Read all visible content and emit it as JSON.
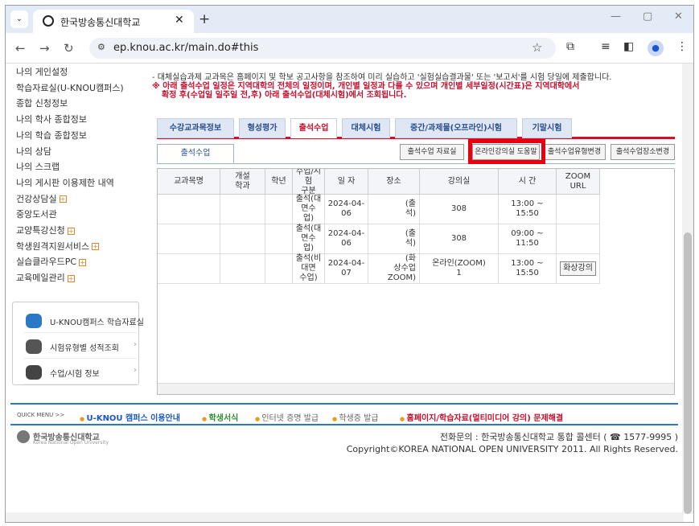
{
  "browser": {
    "tab_title": "한국방송통신대학교",
    "url": "ep.knou.ac.kr/main.do#this"
  },
  "sidebar": {
    "items": [
      {
        "label": "나의 게인설정",
        "plus": false
      },
      {
        "label": "학습자료실(U-KNOU캠퍼스)",
        "plus": false
      },
      {
        "label": "종합 신청정보",
        "plus": false
      },
      {
        "label": "나의 학사 종합정보",
        "plus": false
      },
      {
        "label": "나의 학습 종합정보",
        "plus": false
      },
      {
        "label": "나의 상담",
        "plus": false
      },
      {
        "label": "나의 스크랩",
        "plus": false
      },
      {
        "label": "나의 게시판 이용제한 내역",
        "plus": false
      },
      {
        "label": "건강상담실",
        "plus": true
      },
      {
        "label": "중앙도서관",
        "plus": false
      },
      {
        "label": "교양특강신청",
        "plus": true
      },
      {
        "label": "학생원격지원서비스",
        "plus": true
      },
      {
        "label": "실습클라우드PC",
        "plus": true
      },
      {
        "label": "교육메일관리",
        "plus": true
      }
    ],
    "quick": [
      {
        "label": "U-KNOU캠퍼스 학습자료실"
      },
      {
        "label": "시험유형별 성적조회"
      },
      {
        "label": "수업/시험 정보"
      }
    ]
  },
  "notice": {
    "line1": "- 대체실습과제 교과목은 홈페이지 및 학보 공고사항을 참조하여 미리 실습하고 '실험실습결과물' 또는 '보고서'를 시험 당일에 제출합니다.",
    "line2": "※ 아래 출석수업 일정은 지역대학의 전체의 일정이며, 개인별 일정과 다를 수 있으며 개인별 세부일정(시간표)은 지역대학에서",
    "line3": "확정 후(수업일 일주일 전,후) 아래 출석수업(대체시험)에서 조회됩니다."
  },
  "tabs": [
    "수강교과목정보",
    "형성평가",
    "출석수업",
    "대체시험",
    "중간/과제물(오프라인)시험",
    "기말시험"
  ],
  "active_tab": 2,
  "subtab": "출석수업",
  "buttons": [
    "출석수업 자료실",
    "온라인강의실 도움말",
    "출석수업유형변경",
    "출석수업장소변경"
  ],
  "table": {
    "headers": [
      "교과목명",
      "개설\n학과",
      "학년",
      "수업/시험\n구분",
      "일  자",
      "장소",
      "강의실",
      "시  간",
      "ZOOM\nURL"
    ],
    "rows": [
      [
        "",
        "",
        "",
        "출석(대면수\n업)",
        "2024-04-06",
        "(출\n석)",
        "308",
        "13:00 ~\n15:50",
        ""
      ],
      [
        "",
        "",
        "",
        "출석(대면수\n업)",
        "2024-04-06",
        "(출\n석)",
        "308",
        "09:00 ~\n11:50",
        ""
      ],
      [
        "",
        "",
        "",
        "출석(비대면\n수업)",
        "2024-04-07",
        "(화\n상수업ZOOM)",
        "온라인(ZOOM)\n1",
        "13:00 ~\n15:50",
        "화상강의"
      ]
    ]
  },
  "quickmenu": {
    "label": "QUICK MENU >>",
    "links": [
      {
        "text": "U-KNOU 캠퍼스 이용안내",
        "color": "#1a56c9",
        "bold": true
      },
      {
        "text": "학생서식",
        "color": "#2f8f2f",
        "bold": true
      },
      {
        "text": "인터넷 증명 발급",
        "color": "#666",
        "bold": false
      },
      {
        "text": "학생증 발급",
        "color": "#666",
        "bold": false
      },
      {
        "text": "홈페이지/학습자료(멀티미디어 강의) 문제해결",
        "color": "#c8102e",
        "bold": true
      }
    ]
  },
  "footer": {
    "logo": "한국방송통신대학교",
    "logo_en": "Korea National Open University",
    "contact": "전화문의 : 한국방송통신대학교 통합 콜센터 ( ☎ 1577-9995 )",
    "copyright": "Copyright©KOREA NATIONAL OPEN UNIVERSITY 2011. All Rights Reserved."
  }
}
